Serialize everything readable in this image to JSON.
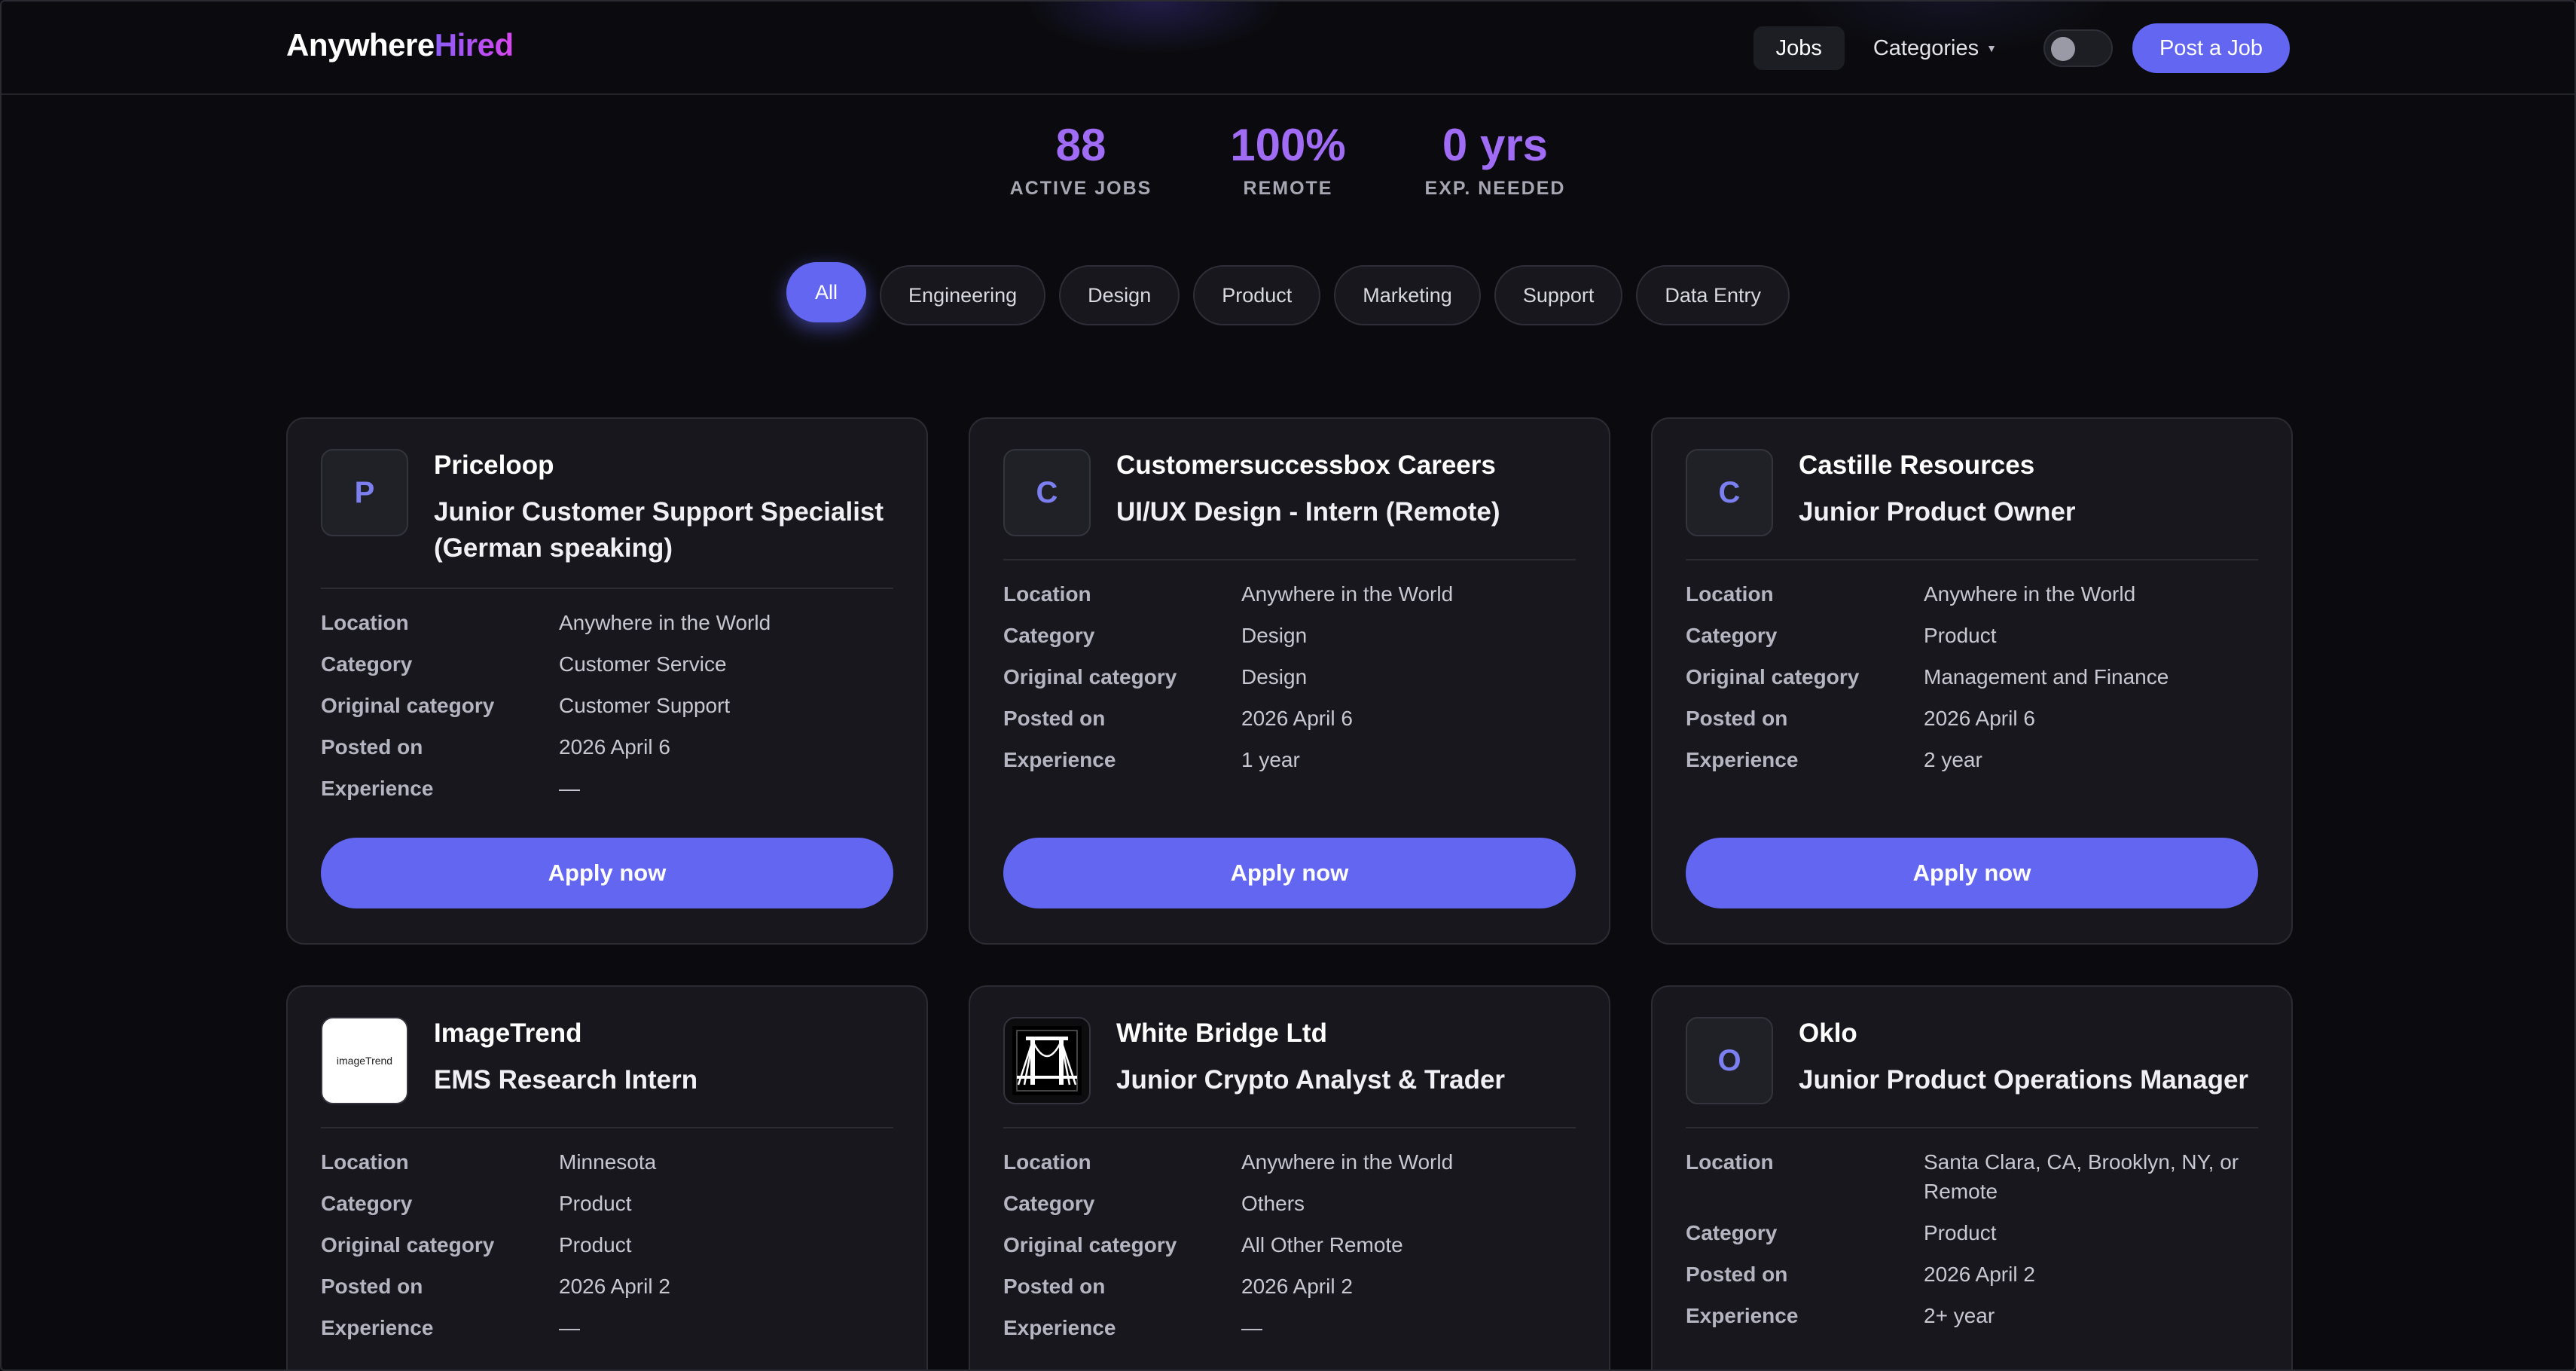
{
  "brand": {
    "part1": "Anywhere",
    "part2": "Hired"
  },
  "nav": {
    "jobs": "Jobs",
    "categories": "Categories",
    "post": "Post a Job"
  },
  "stats": [
    {
      "value": "88",
      "label": "ACTIVE JOBS"
    },
    {
      "value": "100%",
      "label": "REMOTE"
    },
    {
      "value": "0 yrs",
      "label": "EXP. NEEDED"
    }
  ],
  "filters": [
    "All",
    "Engineering",
    "Design",
    "Product",
    "Marketing",
    "Support",
    "Data Entry"
  ],
  "labels": {
    "location": "Location",
    "category": "Category",
    "original": "Original category",
    "posted": "Posted on",
    "experience": "Experience",
    "apply": "Apply now"
  },
  "cards": [
    {
      "initial": "P",
      "company": "Priceloop",
      "title": "Junior Customer Support Specialist (German speaking)",
      "location": "Anywhere in the World",
      "category": "Customer Service",
      "original": "Customer Support",
      "posted": "2026 April 6",
      "experience": "—"
    },
    {
      "initial": "C",
      "company": "Customersuccessbox Careers",
      "title": "UI/UX Design - Intern (Remote)",
      "location": "Anywhere in the World",
      "category": "Design",
      "original": "Design",
      "posted": "2026 April 6",
      "experience": "1 year"
    },
    {
      "initial": "C",
      "company": "Castille Resources",
      "title": "Junior Product Owner",
      "location": "Anywhere in the World",
      "category": "Product",
      "original": "Management and Finance",
      "posted": "2026 April 6",
      "experience": "2 year"
    },
    {
      "initial": "",
      "logo_text": "imageTrend",
      "company": "ImageTrend",
      "title": "EMS Research Intern",
      "location": "Minnesota",
      "category": "Product",
      "original": "Product",
      "posted": "2026 April 2",
      "experience": "—"
    },
    {
      "initial": "",
      "company": "White Bridge Ltd",
      "title": "Junior Crypto Analyst & Trader",
      "location": "Anywhere in the World",
      "category": "Others",
      "original": "All Other Remote",
      "posted": "2026 April 2",
      "experience": "—"
    },
    {
      "initial": "O",
      "company": "Oklo",
      "title": "Junior Product Operations Manager",
      "location": "Santa Clara, CA, Brooklyn, NY, or Remote",
      "category": "Product",
      "posted": "2026 April 2",
      "experience": "2+ year"
    }
  ]
}
